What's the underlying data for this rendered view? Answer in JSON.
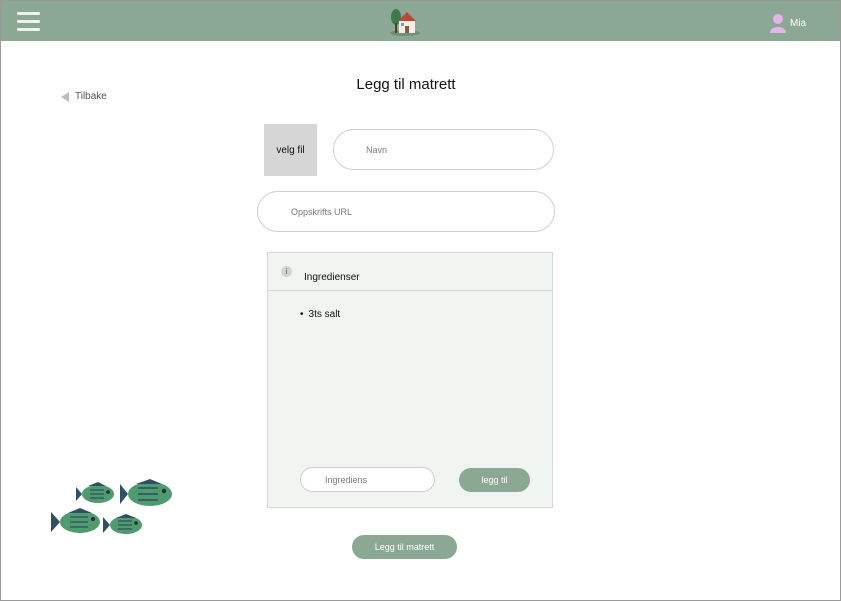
{
  "header": {
    "menu_icon": "hamburger-menu-icon",
    "logo_icon": "house-logo-icon",
    "user_icon": "user-avatar-icon",
    "user_name": "Mia",
    "accent_color": "#8aa893"
  },
  "nav": {
    "back_label": "Tilbake",
    "back_icon": "back-arrow-icon"
  },
  "page": {
    "title": "Legg til matrett"
  },
  "form": {
    "file_button_label": "velg fil",
    "name_placeholder": "Navn",
    "url_placeholder": "Oppskrifts URL"
  },
  "ingredients": {
    "info_icon": "info-icon",
    "info_glyph": "i",
    "title": "Ingredienser",
    "items": [
      "3ts salt"
    ],
    "input_placeholder": "Ingrediens",
    "add_label": "legg til"
  },
  "submit_label": "Legg til matrett",
  "decor": {
    "fish_icon": "fish-school-icon"
  }
}
